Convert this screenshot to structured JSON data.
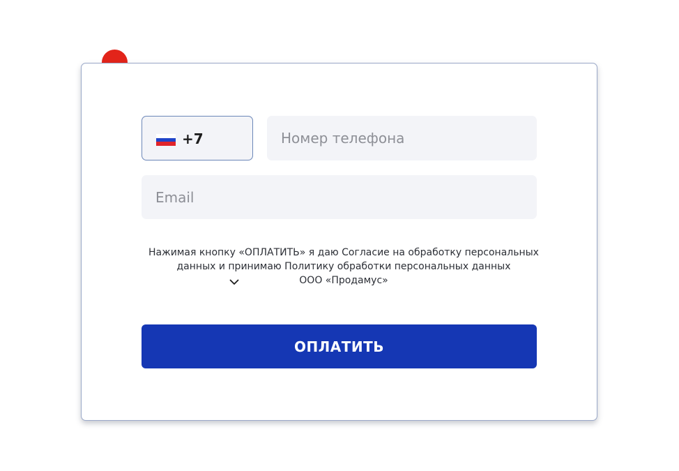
{
  "colors": {
    "accent_dot": "#e2241a",
    "button_bg": "#1537b4",
    "flag_white": "#ffffff",
    "flag_blue": "#1f44c9",
    "flag_red": "#e0242a"
  },
  "phone": {
    "country_flag_icon": "russia-flag-icon",
    "country_code": "+7",
    "placeholder": "Номер телефона",
    "value": ""
  },
  "email": {
    "placeholder": "Email",
    "value": ""
  },
  "consent": {
    "line1": "Нажимая кнопку «ОПЛАТИТЬ» я даю Согласие на обработку персональных",
    "line2": "данных и принимаю Политику обработки персональных данных",
    "line3": "ООО «Продамус»",
    "expand_icon": "chevron-down-icon"
  },
  "pay_button": {
    "label": "ОПЛАТИТЬ"
  }
}
